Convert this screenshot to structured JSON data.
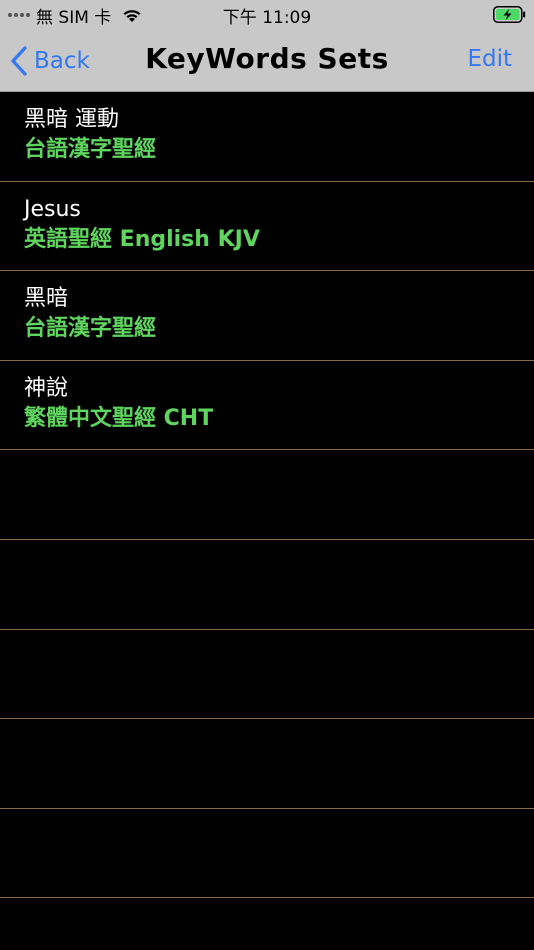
{
  "status": {
    "carrier": "無 SIM 卡",
    "time": "下午 11:09"
  },
  "nav": {
    "back_label": "Back",
    "title": "KeyWords Sets",
    "edit_label": "Edit"
  },
  "rows": [
    {
      "title": "黑暗 運動",
      "subtitle": "台語漢字聖經"
    },
    {
      "title": "Jesus",
      "subtitle": "英語聖經 English KJV"
    },
    {
      "title": "黑暗",
      "subtitle": "台語漢字聖經"
    },
    {
      "title": "神說",
      "subtitle": "繁體中文聖經 CHT"
    },
    {
      "title": "",
      "subtitle": ""
    },
    {
      "title": "",
      "subtitle": ""
    },
    {
      "title": "",
      "subtitle": ""
    },
    {
      "title": "",
      "subtitle": ""
    },
    {
      "title": "",
      "subtitle": ""
    }
  ],
  "colors": {
    "accent": "#3478f6",
    "subtitle": "#5fd45f",
    "separator": "#8a6a4a"
  }
}
